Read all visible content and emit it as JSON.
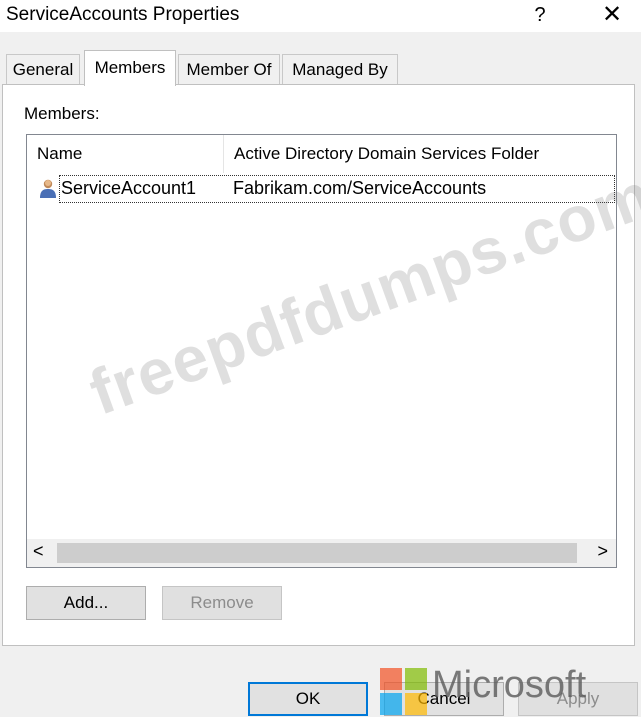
{
  "window": {
    "title": "ServiceAccounts Properties",
    "help_glyph": "?",
    "close_glyph": "✕"
  },
  "tabs": [
    {
      "label": "General"
    },
    {
      "label": "Members",
      "active": true
    },
    {
      "label": "Member Of"
    },
    {
      "label": "Managed By"
    }
  ],
  "members": {
    "label": "Members:",
    "columns": [
      "Name",
      "Active Directory Domain Services Folder"
    ],
    "rows": [
      {
        "name": "ServiceAccount1",
        "folder": "Fabrikam.com/ServiceAccounts",
        "icon": "user-icon"
      }
    ],
    "scroll_left": "<",
    "scroll_right": ">"
  },
  "buttons": {
    "add": "Add...",
    "remove": "Remove",
    "ok": "OK",
    "cancel": "Cancel",
    "apply": "Apply"
  },
  "watermark": {
    "text": "freepdfdumps.com",
    "logo_text": "Microsoft"
  }
}
